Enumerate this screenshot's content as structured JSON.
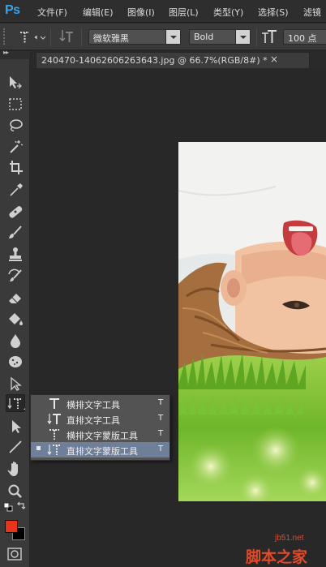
{
  "app": {
    "logo": "Ps"
  },
  "menu": [
    "文件(F)",
    "编辑(E)",
    "图像(I)",
    "图层(L)",
    "类型(Y)",
    "选择(S)",
    "滤镜"
  ],
  "options": {
    "font_family": "微软雅黑",
    "font_style": "Bold",
    "font_size": "100 点"
  },
  "document": {
    "tab_title": "240470-14062606263643.jpg @ 66.7%(RGB/8#) *",
    "close_glyph": "×"
  },
  "colors": {
    "foreground": "#e8341b",
    "background": "#000000",
    "flyout_selected": "#6f7e99"
  },
  "flyout": {
    "items": [
      {
        "label": "横排文字工具",
        "shortcut": "T",
        "icon": "horizontal-type-icon",
        "selected": false
      },
      {
        "label": "直排文字工具",
        "shortcut": "T",
        "icon": "vertical-type-icon",
        "selected": false
      },
      {
        "label": "横排文字蒙版工具",
        "shortcut": "T",
        "icon": "horizontal-type-mask-icon",
        "selected": false
      },
      {
        "label": "直排文字蒙版工具",
        "shortcut": "T",
        "icon": "vertical-type-mask-icon",
        "selected": true
      }
    ]
  },
  "watermark": {
    "domain": "jb51.net",
    "name": "脚本之家"
  }
}
